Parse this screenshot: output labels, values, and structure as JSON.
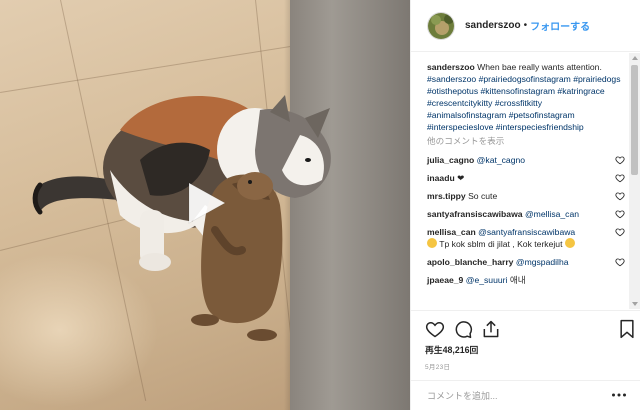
{
  "video": {
    "play_icon": "play-icon"
  },
  "header": {
    "username": "sanderszoo",
    "separator": "•",
    "follow_label": "フォローする"
  },
  "caption": {
    "username": "sanderszoo",
    "text": "When bae really wants attention.",
    "hashtags": [
      "#sanderszoo",
      "#prairiedogsofinstagram",
      "#prairiedogs",
      "#otisthepotus",
      "#kittensofinstagram",
      "#katringrace",
      "#crescentcitykitty",
      "#crossfitkitty",
      "#animalsofinstagram",
      "#petsofinstagram",
      "#interspecieslove",
      "#interspeciesfriendship"
    ]
  },
  "view_all_comments": "他のコメントを表示",
  "comments": [
    {
      "username": "julia_cagno",
      "mention": "@kat_cagno",
      "text": ""
    },
    {
      "username": "inaadu",
      "mention": "",
      "text": "❤"
    },
    {
      "username": "mrs.tippy",
      "mention": "",
      "text": "So cute"
    },
    {
      "username": "santyafransiscawibawa",
      "mention": "@mellisa_can",
      "text": ""
    },
    {
      "username": "mellisa_can",
      "mention": "@santyafransiscawibawa",
      "text": "Tp kok sblm di jilat , Kok terkejut"
    },
    {
      "username": "apolo_blanche_harry",
      "mention": "@mgspadilha",
      "text": ""
    },
    {
      "username": "jpaeae_9",
      "mention": "@e_suuuri",
      "text": "애내"
    }
  ],
  "actions": {
    "icons": [
      "heart-icon",
      "comment-icon",
      "share-icon",
      "bookmark-icon"
    ],
    "views": "再生48,216回",
    "date": "5月23日"
  },
  "add_comment": {
    "placeholder": "コメントを追加...",
    "more_icon": "more-options-icon"
  },
  "colors": {
    "link_blue": "#3897f0",
    "hashtag": "#003569",
    "text": "#262626",
    "muted": "#999999"
  }
}
